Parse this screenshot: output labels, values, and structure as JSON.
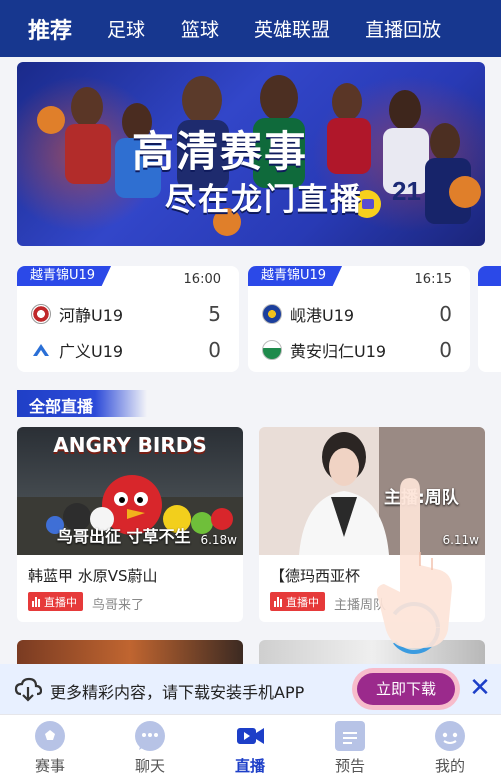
{
  "top_nav": {
    "tabs": [
      {
        "label": "推荐",
        "active": true
      },
      {
        "label": "足球"
      },
      {
        "label": "篮球"
      },
      {
        "label": "英雄联盟"
      },
      {
        "label": "直播回放"
      }
    ],
    "background": "#17378f"
  },
  "banner": {
    "title_line1": "高清赛事",
    "title_line2": "尽在龙门直播"
  },
  "matches": [
    {
      "league": "越青锦U19",
      "time": "16:00",
      "home": {
        "name": "河静U19",
        "score": "5"
      },
      "away": {
        "name": "广义U19",
        "score": "0"
      }
    },
    {
      "league": "越青锦U19",
      "time": "16:15",
      "home": {
        "name": "岘港U19",
        "score": "0"
      },
      "away": {
        "name": "黄安归仁U19",
        "score": "0"
      }
    }
  ],
  "section": {
    "title": "全部直播"
  },
  "live_streams": [
    {
      "thumb_caption": "鸟哥出征 寸草不生",
      "viewers": "6.18w",
      "thumb_brand": "ANGRY BIRDS",
      "title": "韩蓝甲 水原VS蔚山",
      "status": "直播中",
      "author": "鸟哥来了"
    },
    {
      "thumb_caption": "主播:周队",
      "viewers": "6.11w",
      "title": "【德玛西亚杯",
      "status": "直播中",
      "author": "主播周队"
    }
  ],
  "download_bar": {
    "message": "更多精彩内容，请下载安装手机APP",
    "button_label": "立即下载",
    "close_symbol": "✕"
  },
  "bottom_nav": {
    "items": [
      {
        "label": "赛事",
        "icon": "soccer-ball-icon"
      },
      {
        "label": "聊天",
        "icon": "chat-bubble-icon"
      },
      {
        "label": "直播",
        "icon": "video-camera-icon",
        "active": true
      },
      {
        "label": "预告",
        "icon": "calendar-icon"
      },
      {
        "label": "我的",
        "icon": "profile-icon"
      }
    ]
  },
  "colors": {
    "accent_blue": "#1d3fc8",
    "live_red": "#e63a3a",
    "download_button": "#9b2a8c"
  }
}
